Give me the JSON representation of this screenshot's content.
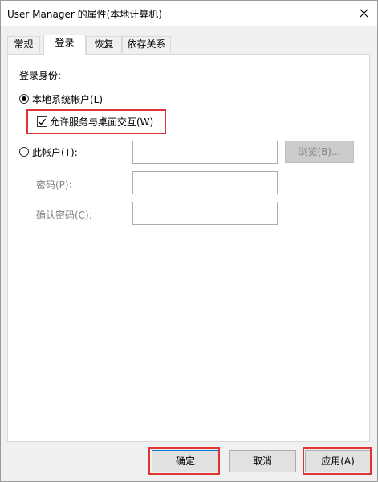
{
  "window": {
    "title": "User Manager 的属性(本地计算机)",
    "close_icon": "close-icon"
  },
  "tabs": [
    {
      "label": "常规",
      "active": false
    },
    {
      "label": "登录",
      "active": true
    },
    {
      "label": "恢复",
      "active": false
    },
    {
      "label": "依存关系",
      "active": false
    }
  ],
  "login": {
    "section_label": "登录身份:",
    "local_system": {
      "label": "本地系统帐户(L)",
      "selected": true
    },
    "allow_desktop": {
      "label": "允许服务与桌面交互(W)",
      "checked": true
    },
    "this_account": {
      "label": "此帐户(T):",
      "selected": false,
      "value": ""
    },
    "browse_button": "浏览(B)...",
    "password": {
      "label": "密码(P):",
      "value": ""
    },
    "confirm_password": {
      "label": "确认密码(C):",
      "value": ""
    }
  },
  "footer": {
    "ok": "确定",
    "cancel": "取消",
    "apply": "应用(A)"
  },
  "colors": {
    "highlight": "#e03333",
    "panel": "#ffffff",
    "window": "#f0f0f0"
  }
}
